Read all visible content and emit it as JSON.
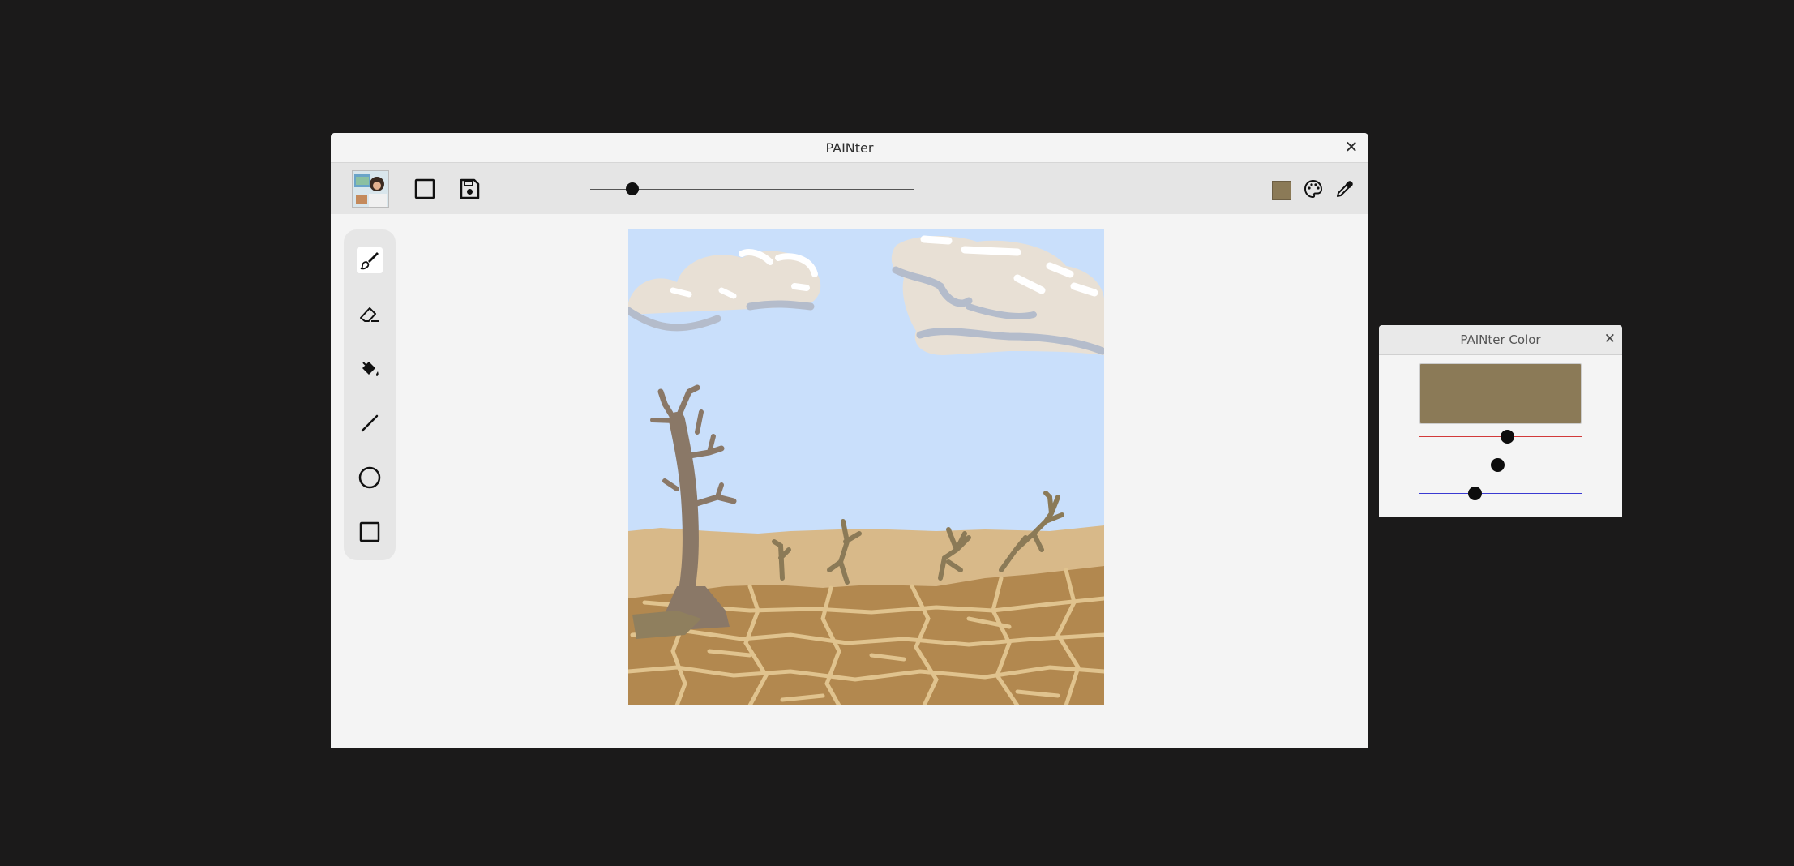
{
  "window": {
    "title": "PAINter"
  },
  "toolbar": {
    "brush_size_level": 0.13,
    "current_color": "#8b7a57"
  },
  "tools": [
    {
      "name": "brush",
      "active": true
    },
    {
      "name": "eraser",
      "active": false
    },
    {
      "name": "fill",
      "active": false
    },
    {
      "name": "line",
      "active": false
    },
    {
      "name": "circle",
      "active": false
    },
    {
      "name": "rectangle",
      "active": false
    }
  ],
  "color_window": {
    "title": "PAINter Color",
    "preview_color": "#8b7a57",
    "red_level": 0.54,
    "green_level": 0.48,
    "blue_level": 0.34,
    "red_line_color": "#d23a3a",
    "green_line_color": "#3fcf3f",
    "blue_line_color": "#3a3ad2"
  },
  "colors": {
    "desktop": "#1b1a1a",
    "sky": "#c9dffb",
    "sand": "#d8b989",
    "ground": "#b2884f",
    "cracks": "#e0c38e",
    "tree": "#8a7867",
    "cactus": "#8b7a57",
    "cloud": "#e8e0d5",
    "cloud_shadow": "#b4bccb"
  }
}
